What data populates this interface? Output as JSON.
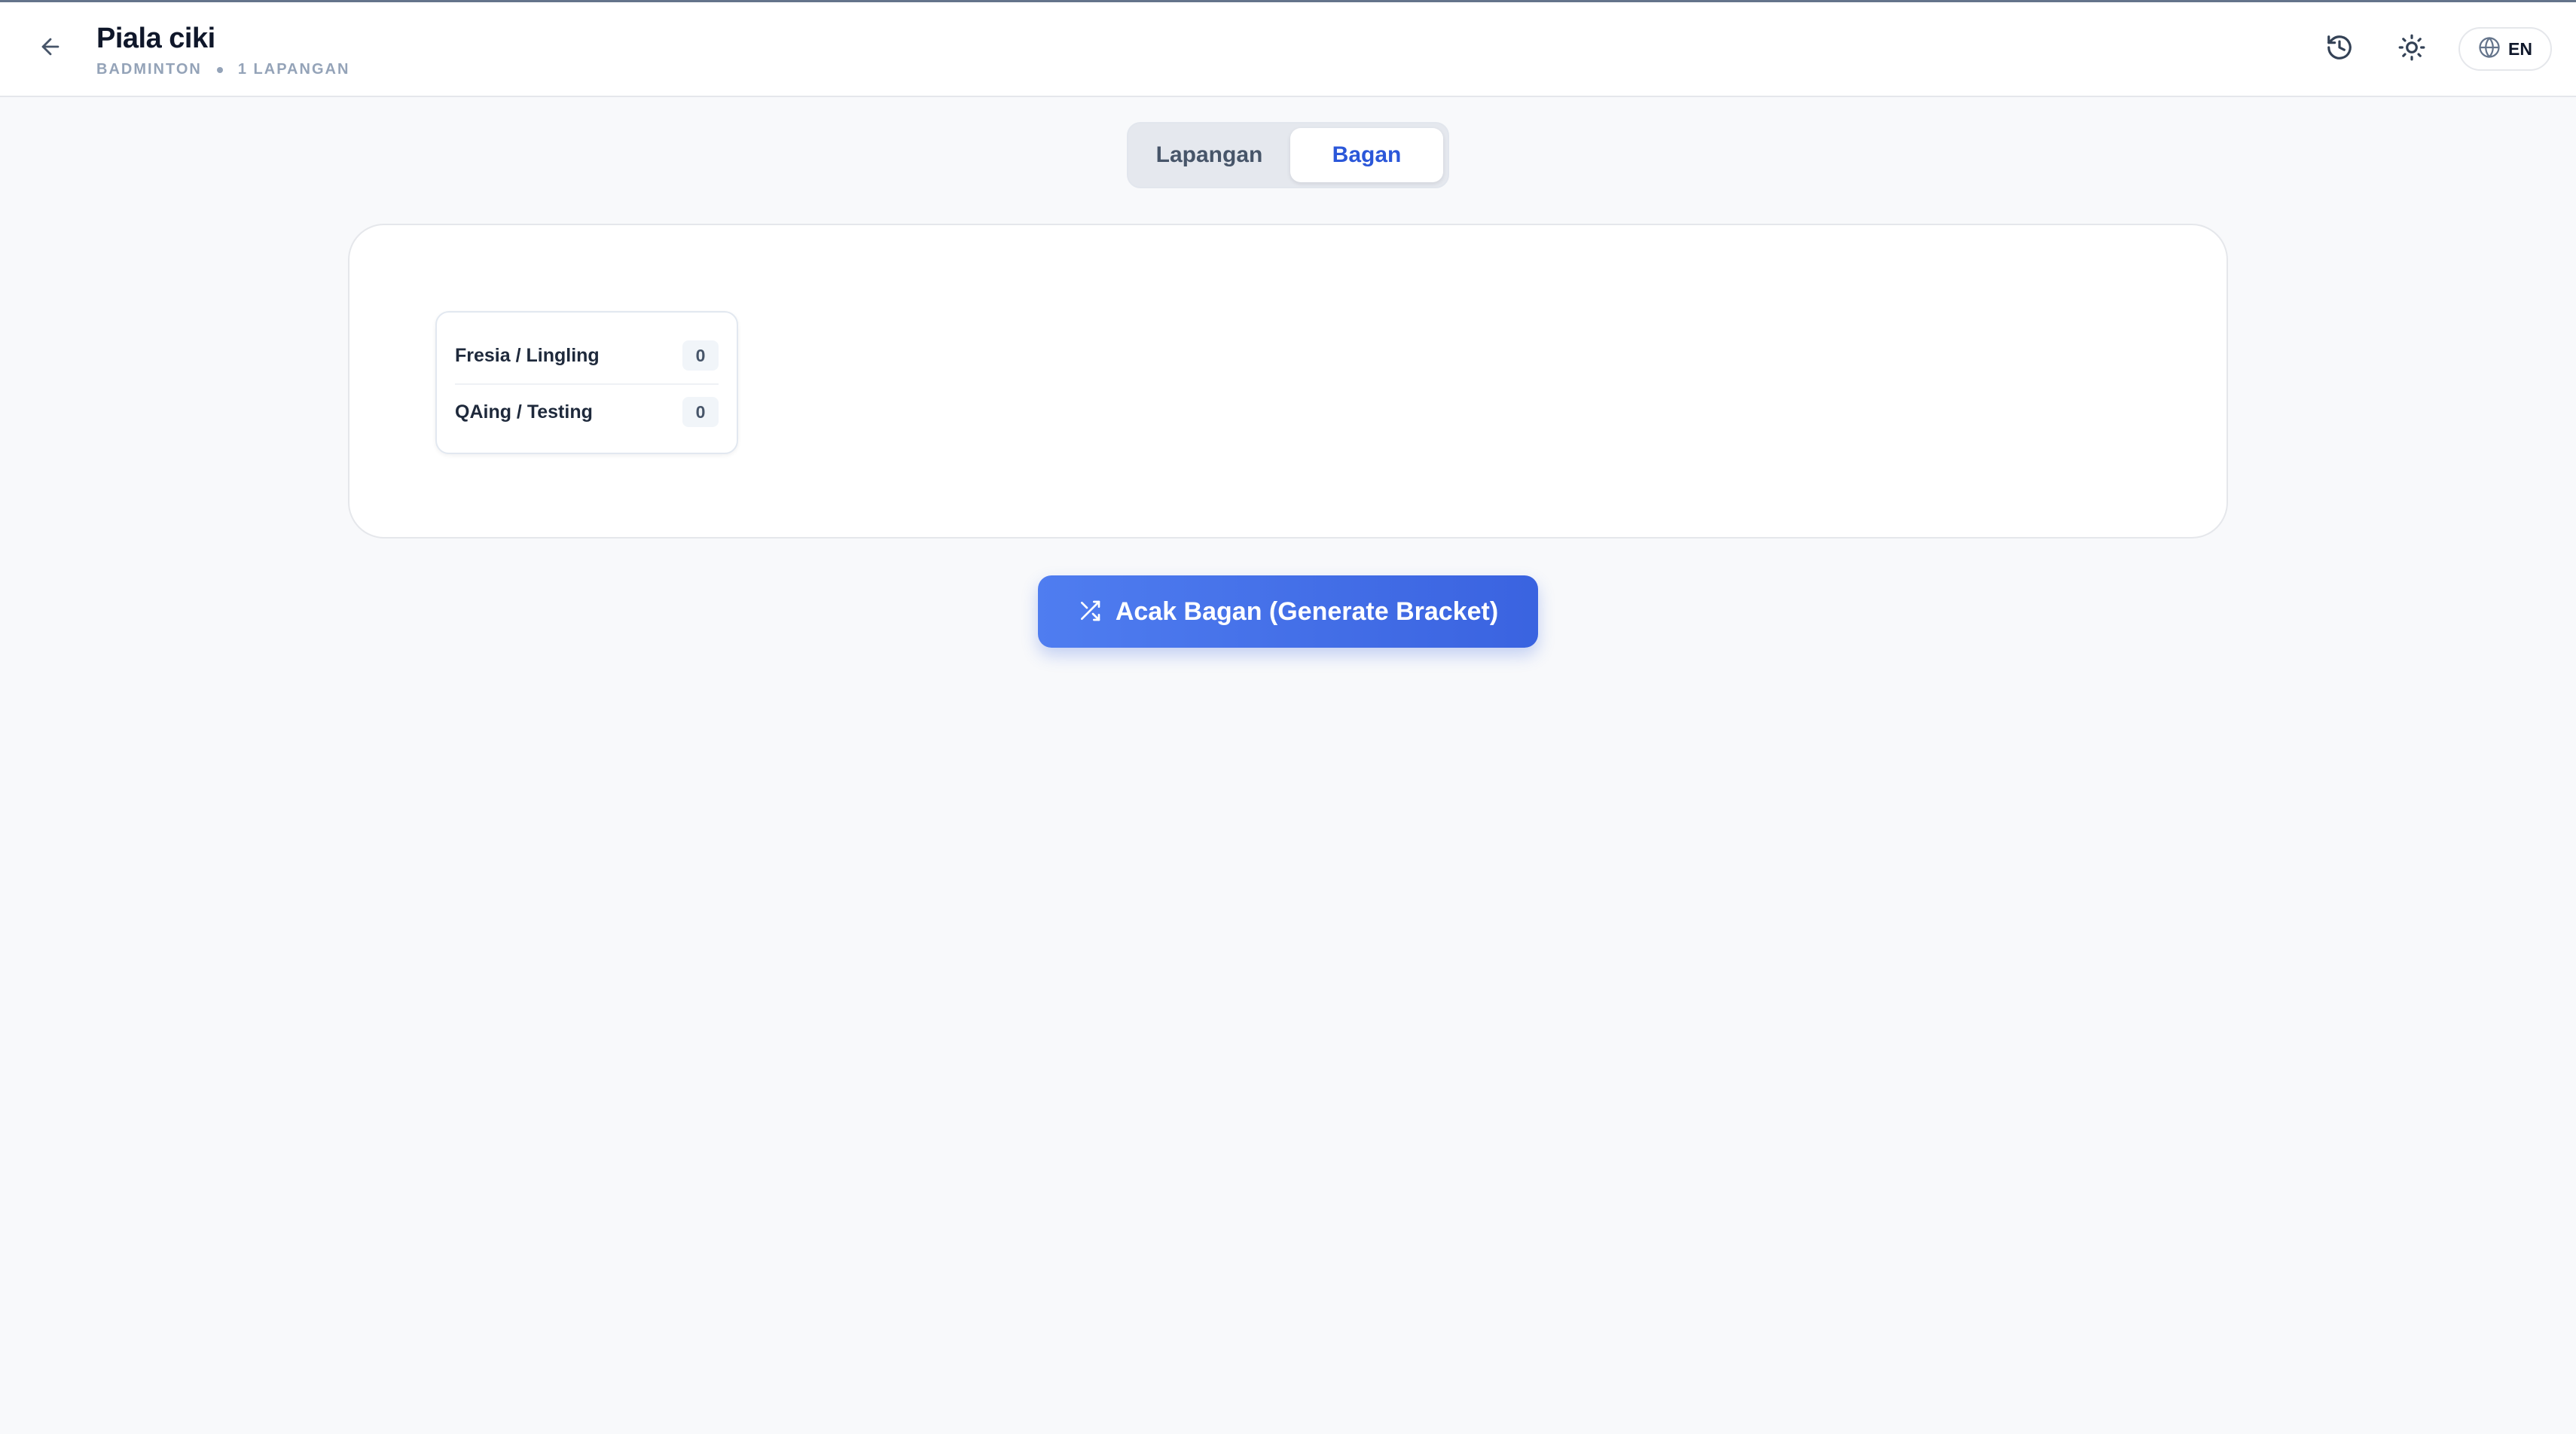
{
  "header": {
    "title": "Piala ciki",
    "sport": "BADMINTON",
    "courts": "1 LAPANGAN",
    "lang_label": "EN",
    "icons": {
      "back": "arrow-left-icon",
      "history": "history-icon",
      "theme": "sun-icon",
      "language": "globe-icon"
    }
  },
  "tabs": [
    {
      "label": "Lapangan",
      "active": false
    },
    {
      "label": "Bagan",
      "active": true
    }
  ],
  "bracket": {
    "match": {
      "teams": [
        {
          "name": "Fresia / Lingling",
          "score": "0"
        },
        {
          "name": "QAing / Testing",
          "score": "0"
        }
      ]
    }
  },
  "actions": {
    "generate_label": "Acak Bagan (Generate Bracket)",
    "generate_icon": "shuffle-icon"
  },
  "colors": {
    "accent": "#3a63e0",
    "active_tab_text": "#2b57d9",
    "page_bg": "#f8f9fb"
  }
}
